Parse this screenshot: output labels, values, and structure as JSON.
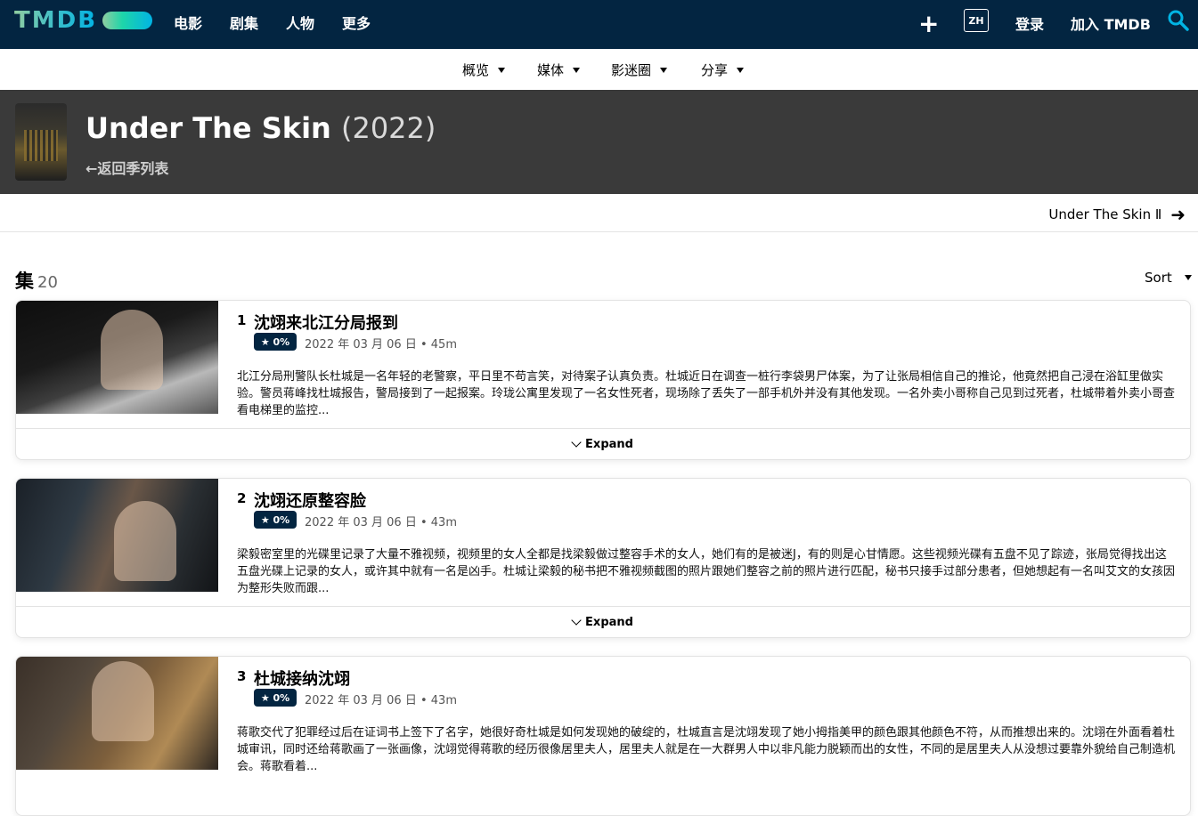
{
  "nav": {
    "logo": "TMDB",
    "items": [
      "电影",
      "剧集",
      "人物",
      "更多"
    ],
    "lang": "ZH",
    "login": "登录",
    "join": "加入 TMDB"
  },
  "subnav": {
    "items": [
      "概览",
      "媒体",
      "影迷圈",
      "分享"
    ]
  },
  "header": {
    "title": "Under The Skin",
    "year": "(2022)",
    "back": "返回季列表"
  },
  "next_season": "Under The Skin Ⅱ",
  "episodes_header": {
    "label": "集",
    "count": "20",
    "sort": "Sort"
  },
  "episodes": [
    {
      "number": "1",
      "title": "沈翊来北江分局报到",
      "rating": "★ 0%",
      "date": "2022 年 03 月 06 日",
      "runtime": "45m",
      "overview": "北江分局刑警队长杜城是一名年轻的老警察，平日里不苟言笑，对待案子认真负责。杜城近日在调查一桩行李袋男尸体案，为了让张局相信自己的推论，他竟然把自己浸在浴缸里做实验。警员蒋峰找杜城报告，警局接到了一起报案。玲珑公寓里发现了一名女性死者，现场除了丢失了一部手机外并没有其他发现。一名外卖小哥称自己见到过死者，杜城带着外卖小哥查看电梯里的监控...",
      "expand": "Expand"
    },
    {
      "number": "2",
      "title": "沈翊还原整容脸",
      "rating": "★ 0%",
      "date": "2022 年 03 月 06 日",
      "runtime": "43m",
      "overview": "梁毅密室里的光碟里记录了大量不雅视频，视频里的女人全都是找梁毅做过整容手术的女人，她们有的是被迷J，有的则是心甘情愿。这些视频光碟有五盘不见了踪迹，张局觉得找出这五盘光碟上记录的女人，或许其中就有一名是凶手。杜城让梁毅的秘书把不雅视频截图的照片跟她们整容之前的照片进行匹配，秘书只接手过部分患者，但她想起有一名叫艾文的女孩因为整形失败而跟...",
      "expand": "Expand"
    },
    {
      "number": "3",
      "title": "杜城接纳沈翊",
      "rating": "★ 0%",
      "date": "2022 年 03 月 06 日",
      "runtime": "43m",
      "overview": "蒋歌交代了犯罪经过后在证词书上签下了名字，她很好奇杜城是如何发现她的破绽的，杜城直言是沈翊发现了她小拇指美甲的颜色跟其他颜色不符，从而推想出来的。沈翊在外面看着杜城审讯，同时还给蒋歌画了一张画像，沈翊觉得蒋歌的经历很像居里夫人，居里夫人就是在一大群男人中以非凡能力脱颖而出的女性，不同的是居里夫人从没想过要靠外貌给自己制造机会。蒋歌看着...",
      "expand": "Expand"
    }
  ],
  "colors": {
    "nav_bg": "#032541",
    "header_bg": "#3a3a3a",
    "rating_bg": "#032541",
    "accent": "#01b4e4"
  }
}
